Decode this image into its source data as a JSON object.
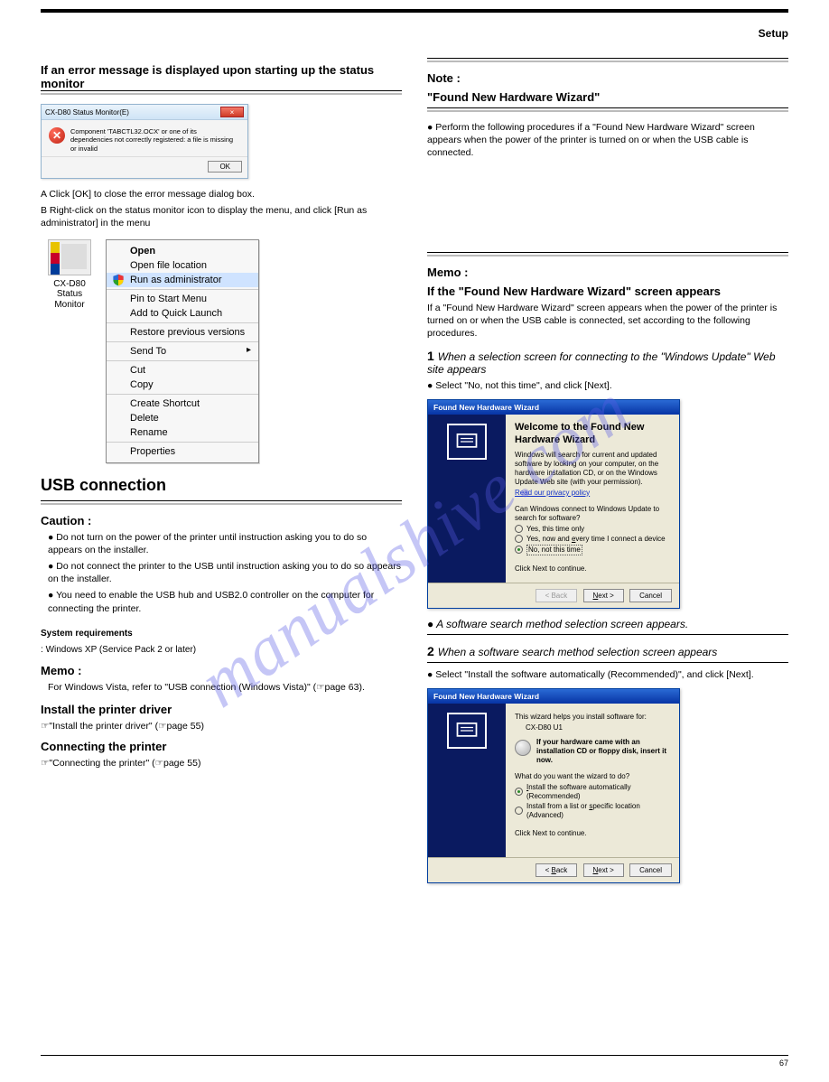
{
  "top_label": "Setup",
  "watermark": "manualshive.com",
  "left_col": {
    "heading": "If an error message is displayed upon starting up the status monitor",
    "err_dialog": {
      "title": "CX-D80 Status Monitor(E)",
      "message": "Component 'TABCTL32.OCX' or one of its dependencies not correctly registered: a file is missing or invalid",
      "button": "OK"
    },
    "steps": [
      "Click [OK] to close the error message dialog box.",
      "Right-click on the status monitor icon to display the menu, and click [Run as administrator] in the menu"
    ],
    "ctx": {
      "icon_label": "CX-D80 Status Monitor",
      "items": [
        {
          "label": "Open",
          "bold": true
        },
        {
          "label": "Open file location"
        },
        {
          "label": "Run as administrator",
          "hilite": true,
          "shield": true
        },
        {
          "sep": true
        },
        {
          "label": "Pin to Start Menu"
        },
        {
          "label": "Add to Quick Launch"
        },
        {
          "sep": true
        },
        {
          "label": "Restore previous versions"
        },
        {
          "sep": true
        },
        {
          "label": "Send To",
          "arrow": true
        },
        {
          "sep": true
        },
        {
          "label": "Cut"
        },
        {
          "label": "Copy"
        },
        {
          "sep": true
        },
        {
          "label": "Create Shortcut"
        },
        {
          "label": "Delete"
        },
        {
          "label": "Rename"
        },
        {
          "sep": true
        },
        {
          "label": "Properties"
        }
      ]
    },
    "usb_h1": "USB connection",
    "caution_label": "Caution :",
    "caution_items": [
      "Do not turn on the power of the printer until instruction asking you to do so appears on the installer.",
      "Do not connect the printer to the USB until instruction asking you to do so appears on the installer.",
      "You need to enable the USB hub and USB2.0 controller on the computer for connecting the printer."
    ],
    "sys_req_label": "System requirements",
    "sys_req_value": "Windows XP (Service Pack 2 or later)",
    "h_memo": "Memo :",
    "h_memo_body": "For Windows Vista, refer to \"USB connection (Windows Vista)\" (☞page 63).",
    "h_ins": "Install the printer driver",
    "ins_text": "☞\"Install the printer driver\" (☞page 55)",
    "h_connect": "Connecting the printer",
    "connect_text": "☞\"Connecting the printer\" (☞page 55)"
  },
  "right_col": {
    "note_label": "Note :",
    "note_hd": "\"Found New Hardware Wizard\"",
    "note_body": "Perform the following procedures if a \"Found New Hardware Wizard\" screen appears when the power of the printer is turned on or when the USB cable is connected.",
    "memo_label": "Memo :",
    "memo_hd": "If the \"Found New Hardware Wizard\" screen appears",
    "memo_body": "If a \"Found New Hardware Wizard\" screen appears when the power of the printer is turned on or when the USB cable is connected, set according to the following procedures.",
    "step1": "When a selection screen for connecting to the \"Windows Update\" Web site appears",
    "step1_body": "Select \"No, not this time\", and click [Next].",
    "wizard1": {
      "title": "Found New Hardware Wizard",
      "heading": "Welcome to the Found New Hardware Wizard",
      "text1": "Windows will search for current and updated software by looking on your computer, on the hardware installation CD, or on the Windows Update Web site (with your permission).",
      "link": "Read our privacy policy",
      "question": "Can Windows connect to Windows Update to search for software?",
      "opts": [
        "Yes, this time only",
        {
          "text_before": "Yes, now and ",
          "u": "e",
          "text_after": "very time I connect a device"
        },
        "No, not this time"
      ],
      "next_hint": "Click Next to continue.",
      "buttons": {
        "back": "< Back",
        "next": "Next >",
        "cancel": "Cancel"
      }
    },
    "w1_caption": "A software search method selection screen appears.",
    "step2": "When a software search method selection screen appears",
    "step2_body": "Select \"Install the software automatically (Recommended)\", and click [Next].",
    "wizard2": {
      "title": "Found New Hardware Wizard",
      "t1": "This wizard helps you install software for:",
      "device": "CX-D80 U1",
      "instruction": "If your hardware came with an installation CD or floppy disk, insert it now.",
      "question": "What do you want the wizard to do?",
      "opts": [
        {
          "text_before": "",
          "u": "I",
          "text_after": "nstall the software automatically (Recommended)"
        },
        {
          "text_before": "Install from a list or ",
          "u": "s",
          "text_after": "pecific location (Advanced)"
        }
      ],
      "next_hint": "Click Next to continue.",
      "buttons": {
        "back": "< Back",
        "next": "Next >",
        "cancel": "Cancel"
      }
    }
  },
  "page_no": "67"
}
